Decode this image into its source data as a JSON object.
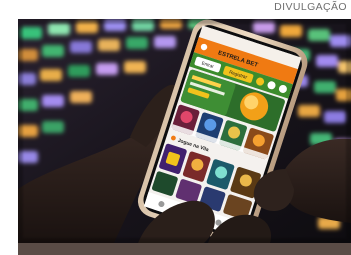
{
  "caption": {
    "credit": "DIVULGAÇÃO"
  },
  "phone_screen": {
    "header_title": "ESTRELA BET",
    "login_label": "Entrar",
    "register_label": "Registrar",
    "section_label": "Jogue na Vila",
    "colors": {
      "header": "#f07a12",
      "green_nav": "#3c8c2c",
      "accent_yellow": "#f2c21c"
    }
  },
  "background": {
    "description_colors": [
      "#2f9c5c",
      "#e6a63a",
      "#8a7ee0",
      "#1f1b26"
    ]
  }
}
